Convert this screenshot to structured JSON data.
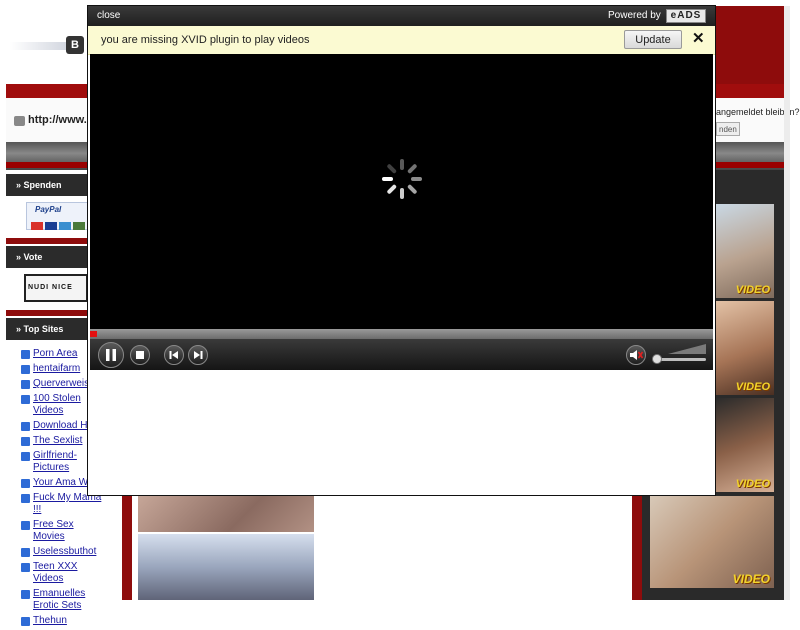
{
  "page": {
    "url_text": "http://www.c",
    "remember_text": "angemeldet bleiben?",
    "login_button": "nden"
  },
  "sidebar": {
    "spenden_label": "» Spenden",
    "paypal_label": "PayPal",
    "vote_label": "» Vote",
    "vote_badge": "NUDI NICE",
    "topsites_label": "» Top Sites",
    "topsites": [
      "Porn Area",
      "hentaifarm",
      "Querverweis",
      "100 Stolen Videos",
      "Download H",
      "The Sexlist",
      "Girlfriend-Pictures",
      "Your Ama W",
      "Fuck My Mama !!!",
      "Free Sex Movies",
      "Uselessbuthot",
      "Teen XXX Videos",
      "Emanuelles Erotic Sets",
      "Thehun"
    ]
  },
  "thumbs": {
    "badge": "VIDEO"
  },
  "overlay": {
    "close_label": "close",
    "powered_label": "Powered by",
    "brand_label": "eADS",
    "notice_text": "you are missing XVID plugin to play videos",
    "update_label": "Update",
    "dismiss_glyph": "✕",
    "progress": 0.012,
    "volume": 0.1
  }
}
